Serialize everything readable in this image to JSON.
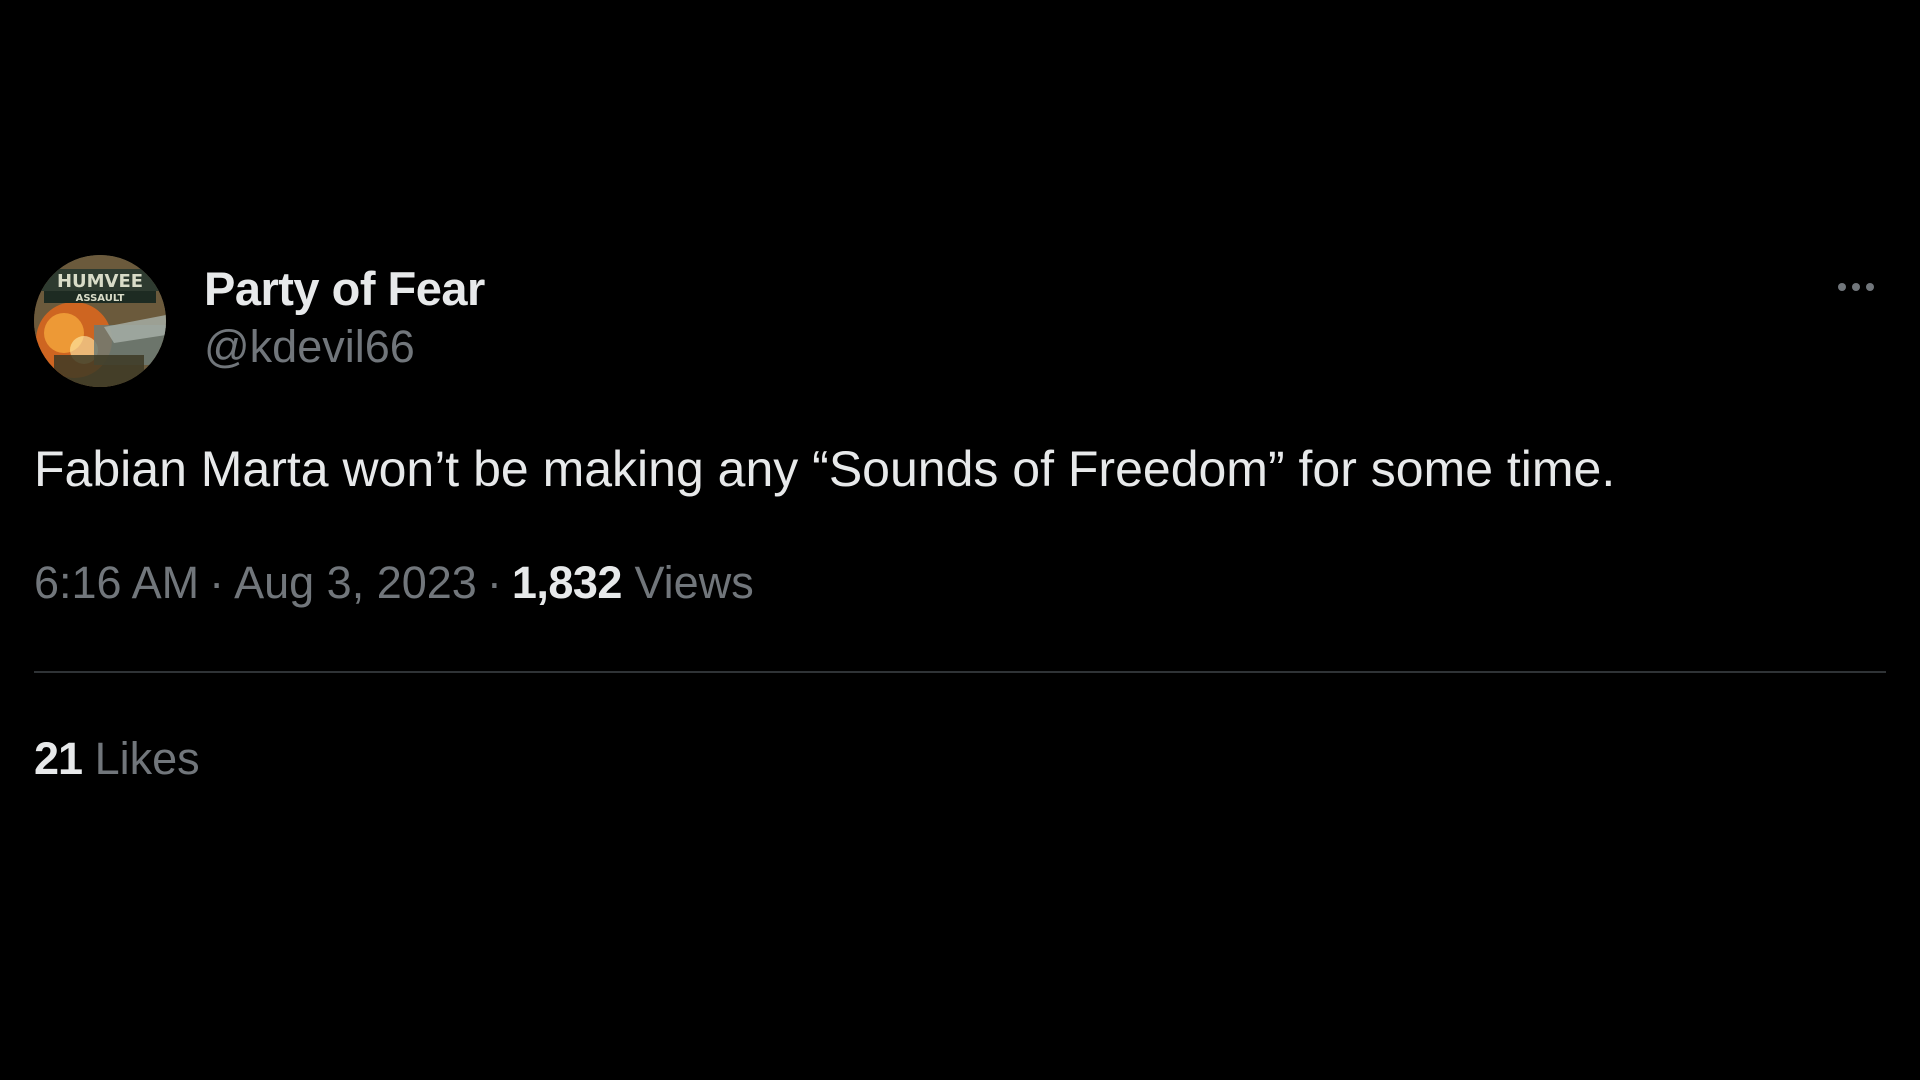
{
  "tweet": {
    "author": {
      "display_name": "Party of Fear",
      "handle": "@kdevil66",
      "avatar_text_top": "HUMVEE",
      "avatar_text_bottom": "ASSAULT"
    },
    "more_icon": "more-horizontal-icon",
    "text": "Fabian Marta won’t be making any “Sounds of Freedom” for some time.",
    "time": "6:16 AM",
    "separator": "·",
    "date": "Aug 3, 2023",
    "views_count": "1,832",
    "views_label": "Views",
    "likes_count": "21",
    "likes_label": "Likes"
  },
  "colors": {
    "background": "#000000",
    "primary_text": "#e7e9ea",
    "secondary_text": "#71767b",
    "divider": "#2f3336"
  }
}
